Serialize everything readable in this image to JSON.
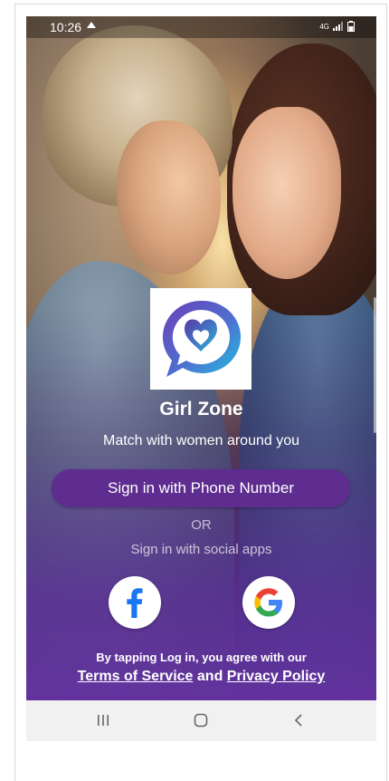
{
  "status_bar": {
    "time": "10:26",
    "network": "4G"
  },
  "app": {
    "name": "Girl Zone",
    "tagline": "Match with women around you"
  },
  "auth": {
    "phone_button_label": "Sign in with Phone Number",
    "or_label": "OR",
    "social_label": "Sign in with social apps",
    "social_buttons": [
      {
        "name": "facebook",
        "icon": "facebook-icon",
        "color": "#1877f2"
      },
      {
        "name": "google",
        "icon": "google-icon"
      }
    ]
  },
  "legal": {
    "intro": "By tapping Log in, you agree with our",
    "terms_link": "Terms of Service",
    "and_text": "and",
    "privacy_link": "Privacy Policy"
  },
  "colors": {
    "primary_button": "#5e2d8f",
    "logo_gradient_start": "#6a3fb5",
    "logo_gradient_end": "#23b5d8"
  },
  "nav_bar": {
    "buttons": [
      "recent-apps-icon",
      "home-icon",
      "back-icon"
    ]
  }
}
